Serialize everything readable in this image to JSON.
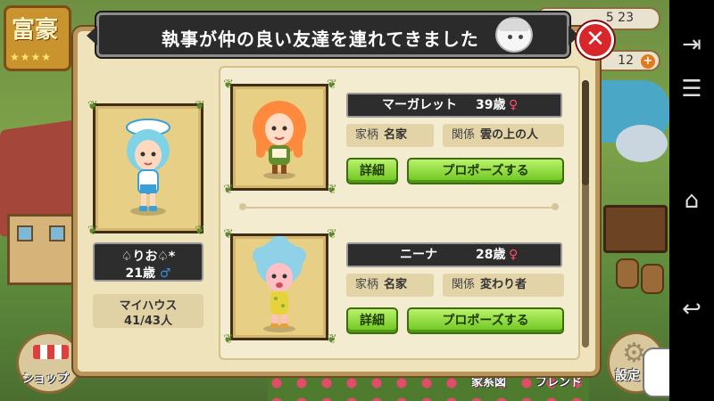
{
  "dialog": {
    "title": "執事が仲の良い友達を連れてきました",
    "close_label": "✕"
  },
  "player": {
    "name": "♤りお♤*",
    "age": "21歳",
    "gender_symbol": "♂",
    "house_label": "マイハウス",
    "house_count": "41/43人"
  },
  "candidates": [
    {
      "name": "マーガレット",
      "age": "39歳",
      "gender_symbol": "♀",
      "family_key": "家柄",
      "family_value": "名家",
      "relation_key": "関係",
      "relation_value": "雲の上の人",
      "detail_label": "詳細",
      "propose_label": "プロポーズする"
    },
    {
      "name": "ニーナ",
      "age": "28歳",
      "gender_symbol": "♀",
      "family_key": "家柄",
      "family_value": "名家",
      "relation_key": "関係",
      "relation_value": "変わり者",
      "detail_label": "詳細",
      "propose_label": "プロポーズする"
    }
  ],
  "background": {
    "rich_badge": "富豪",
    "top_counter_1": "5  23",
    "top_counter_2": "12",
    "shop_label": "ショップ",
    "family_tree_label": "家系図",
    "friend_label": "フレンド",
    "settings_label": "設定"
  },
  "icons": {
    "close": "close-icon",
    "leaf": "leaf-icon",
    "nav_menu": "menu-icon",
    "nav_home": "home-icon",
    "nav_back": "back-icon",
    "nav_forward": "forward-icon"
  },
  "colors": {
    "accent_green": "#6cc31e",
    "close_red": "#d9262b",
    "female": "#ff4b6b",
    "male": "#3d8ee0",
    "dialog_bg": "#efe3bb"
  }
}
